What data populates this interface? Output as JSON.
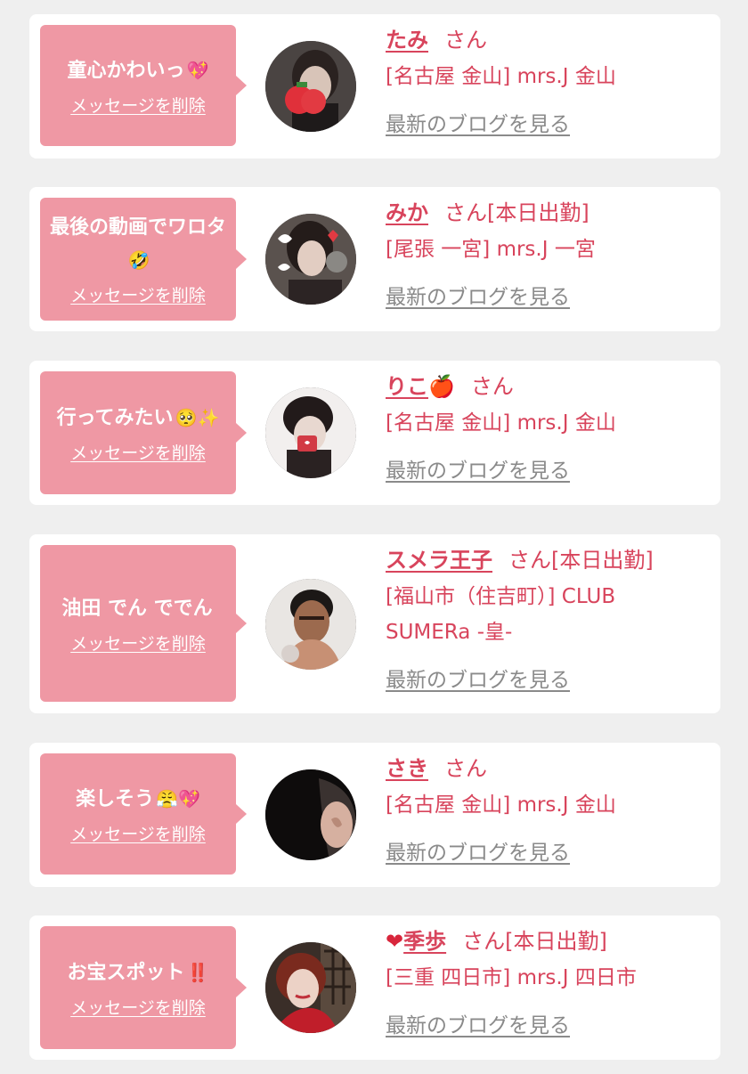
{
  "cards": [
    {
      "message": "童心かわいっ",
      "message_emoji": "💖",
      "delete_label": "メッセージを削除",
      "name": "たみ",
      "name_prefix": "",
      "name_suffix": "",
      "honorific": "さん",
      "status": "",
      "shop": "[名古屋 金山] mrs.J 金山",
      "blog_label": "最新のブログを見る"
    },
    {
      "message": "最後の動画でワロタ",
      "message_emoji": "🤣",
      "delete_label": "メッセージを削除",
      "name": "みか",
      "name_prefix": "",
      "name_suffix": "",
      "honorific": "さん",
      "status": "[本日出勤]",
      "shop": "[尾張 一宮] mrs.J 一宮",
      "blog_label": "最新のブログを見る"
    },
    {
      "message": "行ってみたい",
      "message_emoji": "🥺✨",
      "delete_label": "メッセージを削除",
      "name": "りこ",
      "name_prefix": "",
      "name_suffix": "🍎",
      "honorific": "さん",
      "status": "",
      "shop": "[名古屋 金山] mrs.J 金山",
      "blog_label": "最新のブログを見る"
    },
    {
      "message": "油田 でん ででん",
      "message_emoji": "",
      "delete_label": "メッセージを削除",
      "name": "スメラ王子",
      "name_prefix": "",
      "name_suffix": "",
      "honorific": "さん",
      "status": "[本日出勤]",
      "shop": "[福山市（住吉町）] CLUB SUMERa -皇-",
      "blog_label": "最新のブログを見る"
    },
    {
      "message": "楽しそう",
      "message_emoji": "😤💖",
      "delete_label": "メッセージを削除",
      "name": "さき",
      "name_prefix": "",
      "name_suffix": "",
      "honorific": "さん",
      "status": "",
      "shop": "[名古屋 金山] mrs.J 金山",
      "blog_label": "最新のブログを見る"
    },
    {
      "message": "お宝スポット",
      "message_emoji": "‼️",
      "delete_label": "メッセージを削除",
      "name": "季歩",
      "name_prefix": "❤",
      "name_suffix": "",
      "honorific": "さん",
      "status": "[本日出勤]",
      "shop": "[三重 四日市] mrs.J 四日市",
      "blog_label": "最新のブログを見る"
    }
  ],
  "colors": {
    "page_bg": "#efefef",
    "card_bg": "#ffffff",
    "bubble": "#ef98a4",
    "accent": "#d8445c",
    "link_gray": "#8a8a8a"
  }
}
